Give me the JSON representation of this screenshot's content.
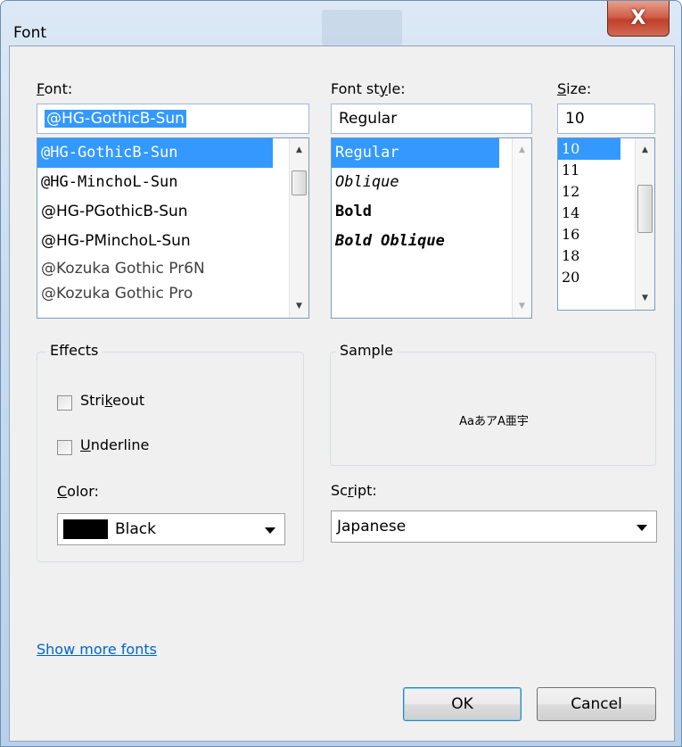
{
  "window": {
    "title": "Font",
    "close_glyph": "X"
  },
  "font": {
    "label_first": "F",
    "label_rest": "ont:",
    "value": "@HG-GothicB-Sun",
    "items": [
      "@HG-GothicB-Sun",
      "@HG-MinchoL-Sun",
      "@HG-PGothicB-Sun",
      "@HG-PMinchoL-Sun",
      "@Kozuka Gothic Pr6N",
      "@Kozuka Gothic Pro"
    ],
    "selected_index": 0
  },
  "style": {
    "label_pre": "Font st",
    "label_u": "y",
    "label_post": "le:",
    "value": "Regular",
    "items": [
      "Regular",
      "Oblique",
      "Bold",
      "Bold Oblique"
    ],
    "selected_index": 0
  },
  "size": {
    "label_first": "S",
    "label_rest": "ize:",
    "value": "10",
    "items": [
      "10",
      "11",
      "12",
      "14",
      "16",
      "18",
      "20"
    ],
    "selected_index": 0
  },
  "effects": {
    "title": "Effects",
    "strikeout_pre": "Stri",
    "strikeout_u": "k",
    "strikeout_post": "eout",
    "strikeout_checked": false,
    "underline_u": "U",
    "underline_post": "nderline",
    "underline_checked": false,
    "color_label_u": "C",
    "color_label_post": "olor:",
    "color_value": "Black",
    "color_swatch": "#000000"
  },
  "sample": {
    "title": "Sample",
    "text": "AaあアA亜宇"
  },
  "script": {
    "label_pre": "Sc",
    "label_u": "r",
    "label_post": "ipt:",
    "value": "Japanese"
  },
  "links": {
    "show_more": "Show more fonts"
  },
  "buttons": {
    "ok": "OK",
    "cancel": "Cancel"
  },
  "colors": {
    "selection": "#3399ff",
    "link": "#0066cc",
    "close_red": "#c0402c"
  }
}
